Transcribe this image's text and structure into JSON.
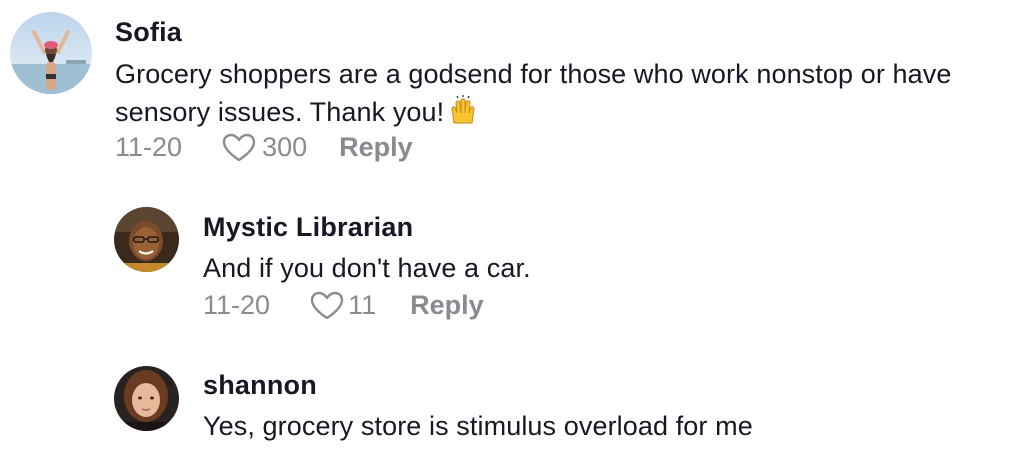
{
  "comments": [
    {
      "username": "Sofia",
      "text": "Grocery shoppers are a godsend for those who work nonstop or have sensory issues. Thank you!",
      "emoji": "raising-hands-emoji",
      "date": "11-20",
      "likes": "300",
      "reply_label": "Reply"
    },
    {
      "username": "Mystic Librarian",
      "text": "And if you don't have a car.",
      "date": "11-20",
      "likes": "11",
      "reply_label": "Reply"
    },
    {
      "username": "shannon",
      "text": "Yes, grocery store is stimulus overload for me"
    }
  ],
  "colors": {
    "text": "#161823",
    "meta": "#8a8b91",
    "background": "#ffffff"
  }
}
